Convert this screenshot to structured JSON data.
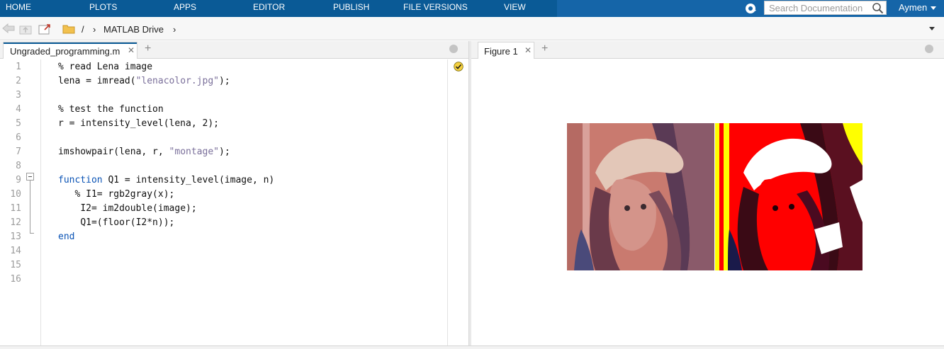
{
  "ribbon": {
    "tabs": [
      "HOME",
      "PLOTS",
      "APPS",
      "EDITOR",
      "PUBLISH",
      "FILE VERSIONS",
      "VIEW"
    ],
    "search_placeholder": "Search Documentation",
    "user_name": "Aymen"
  },
  "pathbar": {
    "separator": "/",
    "folder_name": "MATLAB Drive",
    "chevron": "›"
  },
  "editor": {
    "file_tab": "Ungraded_programming.m",
    "close_glyph": "✕",
    "add_glyph": "+",
    "line_numbers": [
      "1",
      "2",
      "3",
      "4",
      "5",
      "6",
      "7",
      "8",
      "9",
      "10",
      "11",
      "12",
      "13",
      "14",
      "15",
      "16"
    ],
    "lines": [
      {
        "indent": "",
        "parts": [
          {
            "t": "% read Lena image",
            "c": ""
          }
        ]
      },
      {
        "indent": "",
        "parts": [
          {
            "t": "lena = imread(",
            "c": ""
          },
          {
            "t": "\"lenacolor.jpg\"",
            "c": "str"
          },
          {
            "t": ");",
            "c": ""
          }
        ]
      },
      {
        "indent": "",
        "parts": []
      },
      {
        "indent": "",
        "parts": [
          {
            "t": "% test the function",
            "c": ""
          }
        ]
      },
      {
        "indent": "",
        "parts": [
          {
            "t": "r = intensity_level(lena, 2);",
            "c": ""
          }
        ]
      },
      {
        "indent": "",
        "parts": []
      },
      {
        "indent": "",
        "parts": [
          {
            "t": "imshowpair(lena, r, ",
            "c": ""
          },
          {
            "t": "\"montage\"",
            "c": "str"
          },
          {
            "t": ");",
            "c": ""
          }
        ]
      },
      {
        "indent": "",
        "parts": []
      },
      {
        "indent": "",
        "parts": [
          {
            "t": "function",
            "c": "kw"
          },
          {
            "t": " Q1 = intensity_level(image, n)",
            "c": ""
          }
        ]
      },
      {
        "indent": "   ",
        "parts": [
          {
            "t": "% I1= rgb2gray(x);",
            "c": ""
          }
        ]
      },
      {
        "indent": "    ",
        "parts": [
          {
            "t": "I2= im2double(image);",
            "c": ""
          }
        ]
      },
      {
        "indent": "    ",
        "parts": [
          {
            "t": "Q1=(floor(I2*n));",
            "c": ""
          }
        ]
      },
      {
        "indent": "",
        "parts": [
          {
            "t": "end",
            "c": "kw"
          }
        ]
      },
      {
        "indent": "",
        "parts": []
      },
      {
        "indent": "",
        "parts": []
      },
      {
        "indent": "",
        "parts": []
      }
    ]
  },
  "figure": {
    "tab": "Figure 1",
    "close_glyph": "✕",
    "add_glyph": "+"
  },
  "colors": {
    "ribbon": "#0a5a96",
    "keyword": "#0a53b5",
    "string": "#7a6f9a"
  }
}
